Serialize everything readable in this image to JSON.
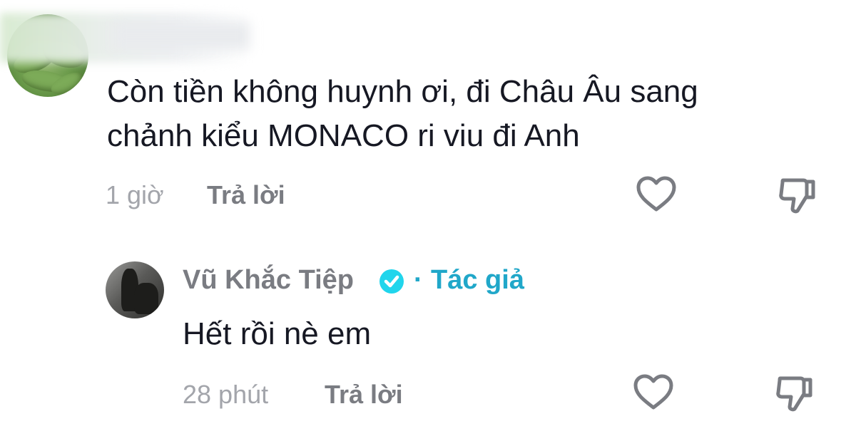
{
  "comments": [
    {
      "text_line1": "Còn tiền không huynh ơi, đi Châu Âu sang",
      "text_line2": "chảnh kiểu MONACO ri viu đi Anh",
      "time": "1 giờ",
      "reply_label": "Trả lời",
      "avatar_icon": "avatar-bitter-melon",
      "like_icon": "heart-outline-icon",
      "dislike_icon": "thumbs-down-outline-icon"
    },
    {
      "author": "Vũ Khắc Tiệp",
      "verified": true,
      "separator": "·",
      "author_badge": "Tác giả",
      "text": "Hết rồi nè em",
      "time": "28 phút",
      "reply_label": "Trả lời",
      "like_icon": "heart-outline-icon",
      "dislike_icon": "thumbs-down-outline-icon"
    }
  ],
  "colors": {
    "text": "#161823",
    "meta": "#a3a5ab",
    "reply": "#7a7c82",
    "author_badge": "#20a7c9",
    "verified": "#20d5ec"
  }
}
